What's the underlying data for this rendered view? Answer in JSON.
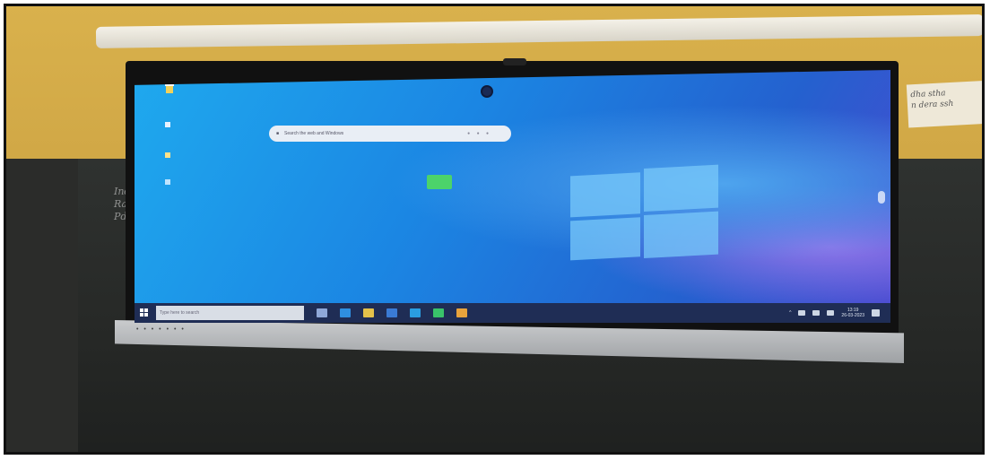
{
  "scene": {
    "chalk_lines": [
      "Ind",
      "Ra",
      "Pd"
    ],
    "paper_note": [
      "dha stha",
      "n dera ssh"
    ]
  },
  "desktop": {
    "search_placeholder": "Search the web and Windows",
    "search_suffix": "● ●  ●"
  },
  "taskbar": {
    "search_placeholder": "Type here to search",
    "apps": [
      {
        "name": "task-view",
        "color": "#8fa8d8"
      },
      {
        "name": "edge",
        "color": "#2f8fe0"
      },
      {
        "name": "explorer",
        "color": "#e3c14a"
      },
      {
        "name": "store",
        "color": "#3a7bd5"
      },
      {
        "name": "mail",
        "color": "#2a9de0"
      },
      {
        "name": "whiteboard",
        "color": "#39c26a"
      },
      {
        "name": "photos",
        "color": "#e8a33c"
      }
    ],
    "time": "13:19",
    "date": "26-03-2023"
  },
  "colors": {
    "taskbar": "#1f2d55",
    "desktop": "#1b86e3"
  }
}
